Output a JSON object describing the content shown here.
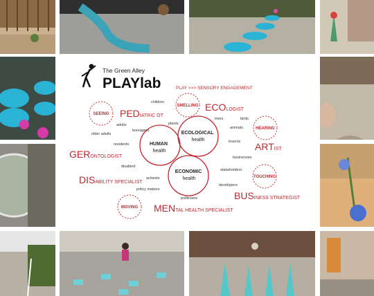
{
  "header": {
    "subtitle": "The Green Alley",
    "title": "PLAYlab",
    "tagline": "PLAY >>> SENSORY ENGAGEMENT"
  },
  "circles": {
    "ecological": [
      "ECOLOGICAL",
      "health"
    ],
    "human": [
      "HUMAN",
      "health"
    ],
    "economic": [
      "ECONOMIC",
      "health"
    ]
  },
  "senses": {
    "seeing": "SEEING",
    "smelling": "SMELLING",
    "hearing": "HEARING",
    "touching": "TOUCHING",
    "moving": "MOVING"
  },
  "professions": {
    "pediatric": {
      "big": "PED",
      "small": "IATRIC OT"
    },
    "ecologist": {
      "big": "ECO",
      "small": "LOGIST"
    },
    "artist": {
      "big": "ART",
      "small": "IST"
    },
    "gerontologist": {
      "big": "GER",
      "small": "ONTOLOGIST"
    },
    "disability": {
      "big": "DIS",
      "small": "ABILITY SPECIALIST"
    },
    "business": {
      "big": "BUS",
      "small": "INESS STRATEGIST"
    },
    "mental": {
      "big": "MEN",
      "small": "TAL HEALTH SPECIALIST"
    }
  },
  "keywords": {
    "children": "children",
    "adults": "adults",
    "teenagers": "teenagers",
    "older_adults": "older adults",
    "residents": "residents",
    "disabled": "disabled",
    "activists": "activists",
    "policy_makers": "policy makers",
    "politicians": "politicians",
    "developers": "developers",
    "stakeholders": "stakeholders",
    "businesses": "businesses",
    "insects": "insects",
    "animals": "animals",
    "trees": "trees",
    "birds": "birds",
    "plants": "plants"
  },
  "colors": {
    "accent": "#c1272d",
    "text": "#333333"
  }
}
